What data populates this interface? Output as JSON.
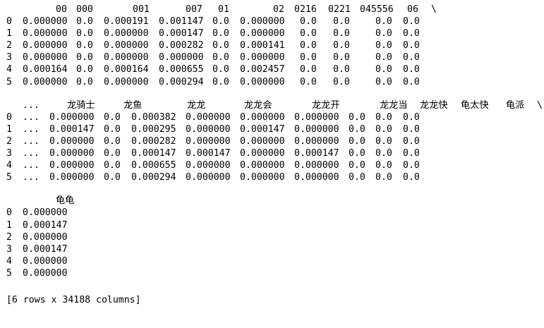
{
  "blocks": [
    {
      "headers": [
        "00",
        "000",
        "001",
        "007",
        "01",
        "02",
        "0216",
        "0221",
        "045556",
        "06",
        "\\"
      ],
      "rows": [
        {
          "index": "0",
          "cells": [
            "0.000000",
            "0.0",
            "0.000191",
            "0.001147",
            "0.0",
            "0.000000",
            "0.0",
            "0.0",
            "0.0",
            "0.0"
          ]
        },
        {
          "index": "1",
          "cells": [
            "0.000000",
            "0.0",
            "0.000000",
            "0.000147",
            "0.0",
            "0.000000",
            "0.0",
            "0.0",
            "0.0",
            "0.0"
          ]
        },
        {
          "index": "2",
          "cells": [
            "0.000000",
            "0.0",
            "0.000000",
            "0.000282",
            "0.0",
            "0.000141",
            "0.0",
            "0.0",
            "0.0",
            "0.0"
          ]
        },
        {
          "index": "3",
          "cells": [
            "0.000000",
            "0.0",
            "0.000000",
            "0.000000",
            "0.0",
            "0.000000",
            "0.0",
            "0.0",
            "0.0",
            "0.0"
          ]
        },
        {
          "index": "4",
          "cells": [
            "0.000164",
            "0.0",
            "0.000164",
            "0.000655",
            "0.0",
            "0.002457",
            "0.0",
            "0.0",
            "0.0",
            "0.0"
          ]
        },
        {
          "index": "5",
          "cells": [
            "0.000000",
            "0.0",
            "0.000000",
            "0.000294",
            "0.0",
            "0.000000",
            "0.0",
            "0.0",
            "0.0",
            "0.0"
          ]
        }
      ]
    },
    {
      "headers": [
        "...",
        "龙骑士",
        "龙鱼",
        "龙龙",
        "龙龙会",
        "龙龙开",
        "龙龙当",
        "龙龙快",
        "龟太快",
        "龟派",
        "\\"
      ],
      "rows": [
        {
          "index": "0",
          "cells": [
            "...",
            "0.000000",
            "0.0",
            "0.000382",
            "0.000000",
            "0.000000",
            "0.000000",
            "0.0",
            "0.0",
            "0.0"
          ]
        },
        {
          "index": "1",
          "cells": [
            "...",
            "0.000147",
            "0.0",
            "0.000295",
            "0.000000",
            "0.000147",
            "0.000000",
            "0.0",
            "0.0",
            "0.0"
          ]
        },
        {
          "index": "2",
          "cells": [
            "...",
            "0.000000",
            "0.0",
            "0.000282",
            "0.000000",
            "0.000000",
            "0.000000",
            "0.0",
            "0.0",
            "0.0"
          ]
        },
        {
          "index": "3",
          "cells": [
            "...",
            "0.000000",
            "0.0",
            "0.000147",
            "0.000147",
            "0.000000",
            "0.000147",
            "0.0",
            "0.0",
            "0.0"
          ]
        },
        {
          "index": "4",
          "cells": [
            "...",
            "0.000000",
            "0.0",
            "0.000655",
            "0.000000",
            "0.000000",
            "0.000000",
            "0.0",
            "0.0",
            "0.0"
          ]
        },
        {
          "index": "5",
          "cells": [
            "...",
            "0.000000",
            "0.0",
            "0.000294",
            "0.000000",
            "0.000000",
            "0.000000",
            "0.0",
            "0.0",
            "0.0"
          ]
        }
      ]
    },
    {
      "headers": [
        "龟龟"
      ],
      "rows": [
        {
          "index": "0",
          "cells": [
            "0.000000"
          ]
        },
        {
          "index": "1",
          "cells": [
            "0.000147"
          ]
        },
        {
          "index": "2",
          "cells": [
            "0.000000"
          ]
        },
        {
          "index": "3",
          "cells": [
            "0.000147"
          ]
        },
        {
          "index": "4",
          "cells": [
            "0.000000"
          ]
        },
        {
          "index": "5",
          "cells": [
            "0.000000"
          ]
        }
      ]
    }
  ],
  "footer": "[6 rows x 34188 columns]"
}
